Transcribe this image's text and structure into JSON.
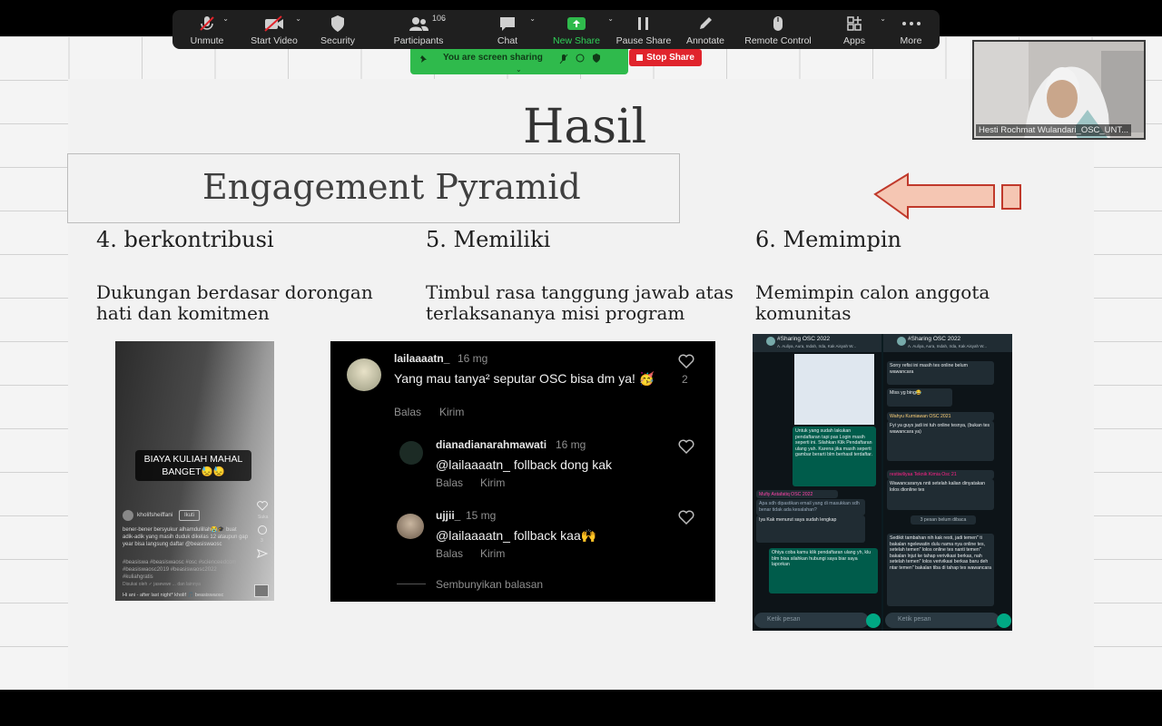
{
  "toolbar": {
    "items": [
      {
        "label": "Unmute",
        "icon": "mic-muted-icon"
      },
      {
        "label": "Start Video",
        "icon": "video-off-icon"
      },
      {
        "label": "Security",
        "icon": "shield-icon"
      },
      {
        "label": "Participants",
        "icon": "participants-icon",
        "count": "106"
      },
      {
        "label": "Chat",
        "icon": "chat-icon"
      },
      {
        "label": "New Share",
        "icon": "share-arrow-icon"
      },
      {
        "label": "Pause Share",
        "icon": "pause-icon"
      },
      {
        "label": "Annotate",
        "icon": "pen-icon"
      },
      {
        "label": "Remote Control",
        "icon": "mouse-icon"
      },
      {
        "label": "Apps",
        "icon": "apps-icon"
      },
      {
        "label": "More",
        "icon": "more-icon"
      }
    ]
  },
  "share_banner": {
    "text": "You are screen sharing",
    "stop_label": "Stop Share"
  },
  "video": {
    "name": "Hesti Rochmat Wulandari_OSC_UNT..."
  },
  "slide": {
    "title": "Hasil",
    "subtitle": "Engagement Pyramid",
    "columns": [
      {
        "heading": "4. berkontribusi",
        "desc": "Dukungan berdasar dorongan hati dan komitmen"
      },
      {
        "heading": "5. Memiliki",
        "desc": "Timbul rasa tanggung jawab atas terlaksananya misi program"
      },
      {
        "heading": "6. Memimpin",
        "desc": "Memimpin calon anggota komunitas"
      }
    ]
  },
  "image1": {
    "banner": "BIAYA KULIAH MAHAL BANGET😓😓",
    "username": "kholifsheiffani",
    "follow": "Ikuti",
    "caption": "bener-bener bersyukur alhamdulillah😭🎓 buat adik-adik yang masih duduk dikelas 12 ataupun gap year bisa langsung daftar @beasiswaosc",
    "tags": "#beasiswa #beasiswaosc #osc #scienceedcom #beasiswaosc2019 #beasiswaosc2022 #kuliahgratis",
    "liked": "Disukai oleh ✓ jasewwe ... dan lainnya",
    "music": "Hi ani - after last night*   kholif  🎵 beasiswaosc",
    "likes_label": "Suka",
    "comments_count": "3"
  },
  "image2": {
    "comments": [
      {
        "user": "lailaaaatn_",
        "time": "16 mg",
        "text": "Yang mau tanya² seputar OSC bisa dm ya! 🥳",
        "reply": "Balas",
        "send": "Kirim",
        "likes": "2"
      },
      {
        "user": "dianadianarahmawati",
        "time": "16 mg",
        "text": "@lailaaaatn_ follback dong kak",
        "reply": "Balas",
        "send": "Kirim"
      },
      {
        "user": "ujjii_",
        "time": "15 mg",
        "text": "@lailaaaatn_ follback kaa🙌",
        "reply": "Balas",
        "send": "Kirim"
      }
    ],
    "hide_replies": "Sembunyikan balasan"
  },
  "image3": {
    "group": "#Sharing OSC 2022",
    "members": "A. Auliya, Aura, Indah, Irda, Kak Aisyah W...",
    "input_placeholder": "Ketik pesan",
    "unread": "3 pesan belum dibaca",
    "left_msgs": [
      "Untuk yang sudah lakukan pendaftaran tapi pas Login masih seperti ini. Silahkan Klik Pendaftaran ulang yah. Karena jika masih seperti gambar berarti blm berhasil terdaftar.",
      "Mufiy Astafatiq OSC 2022",
      "Apa sdh dipastikan email yang di masukkan sdh benar tidak ada kesalahan?",
      "Iya Kak menurut saya sudah lengkap",
      "Ohiya coba kamu klik pendaftaran ulang yh, klu blm bisa silahkan hubungi saya biar saya laporkan"
    ],
    "right_msgs": [
      "Sorry refisi ini masih tes online belum wawancara",
      "Miss yg bing😂",
      "Wahyu Kurniawan OSC 2021",
      "Fyi ya guys jadi ini tuh online tesnya, (bukan tes wawancara ya)",
      "restiwiliyaa Teknik Kimia Osc 21",
      "Wawancaranya nnti setelah kalian dinyatakan lolos dionline tes",
      "Sedikit tambahan nih kak resti, jadi temen\" ti bakalan ngelewatin dulu nama nya online tes, setelah temen\" lolos online tes nanti temen\" bakalan lnjut ke tahap verivikasi berkas, nah setelah temen\" lolos verivikasi berkas baru deh ntar temen\" bakalan tiba di tahap tes wawancara"
    ]
  },
  "colors": {
    "toolbar_bg": "#1f1f1f",
    "share_green": "#2fba4c",
    "stop_red": "#e0242c",
    "arrow_fill": "#f5c6b3",
    "arrow_stroke": "#c0392b"
  }
}
